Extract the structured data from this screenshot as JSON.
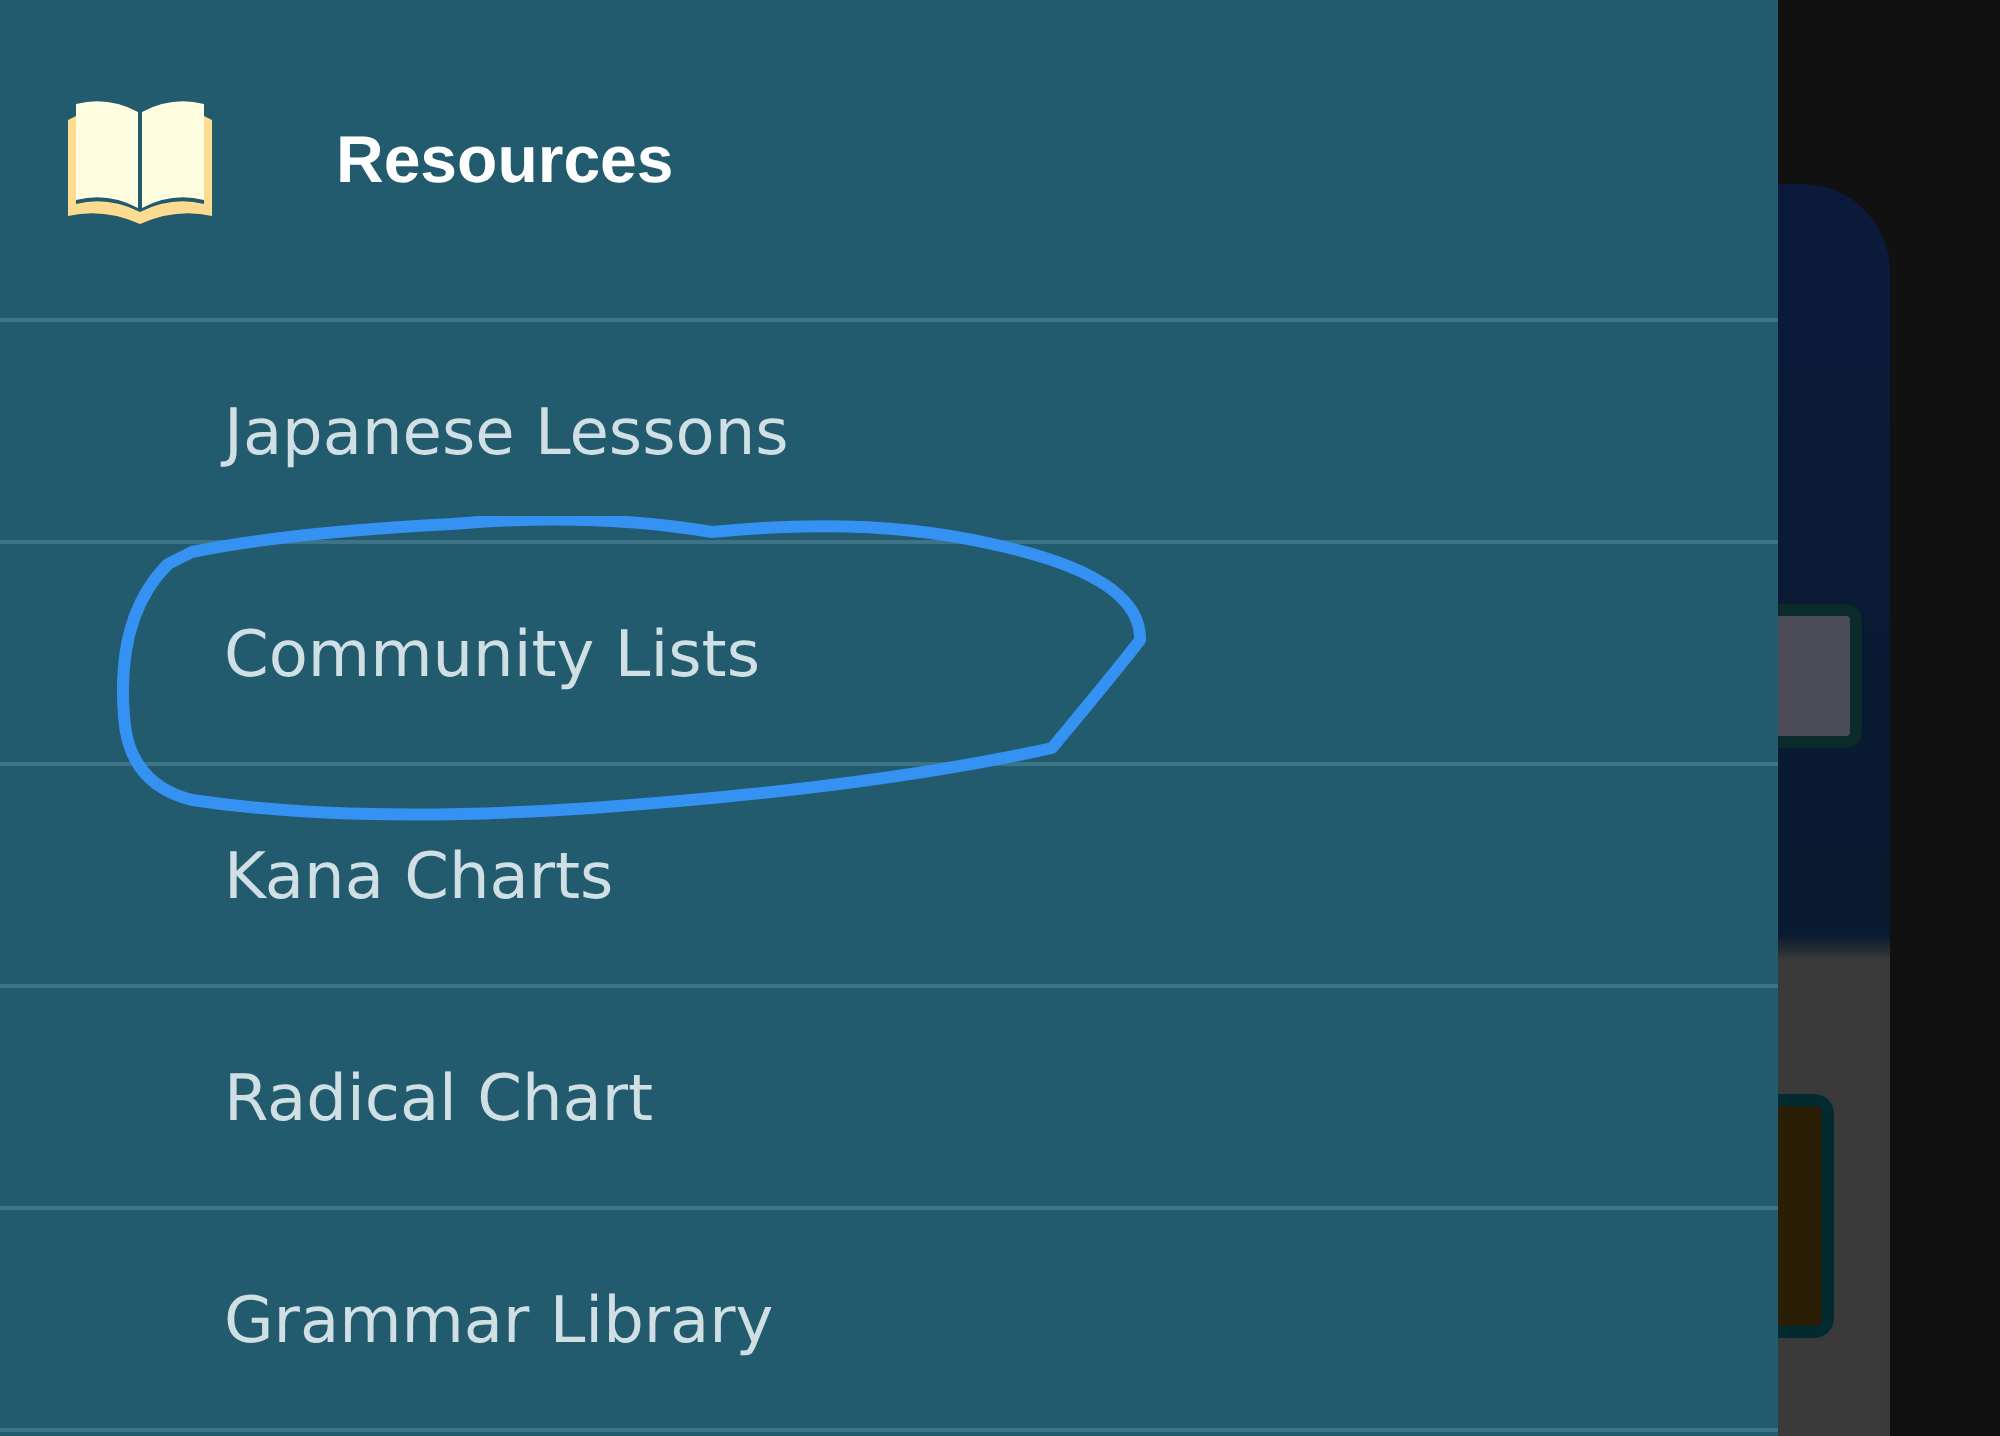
{
  "drawer": {
    "title": "Resources",
    "items": [
      {
        "label": "Japanese Lessons",
        "circled": false
      },
      {
        "label": "Community Lists",
        "circled": true
      },
      {
        "label": "Kana Charts",
        "circled": false
      },
      {
        "label": "Radical Chart",
        "circled": false
      },
      {
        "label": "Grammar Library",
        "circled": false
      }
    ]
  }
}
